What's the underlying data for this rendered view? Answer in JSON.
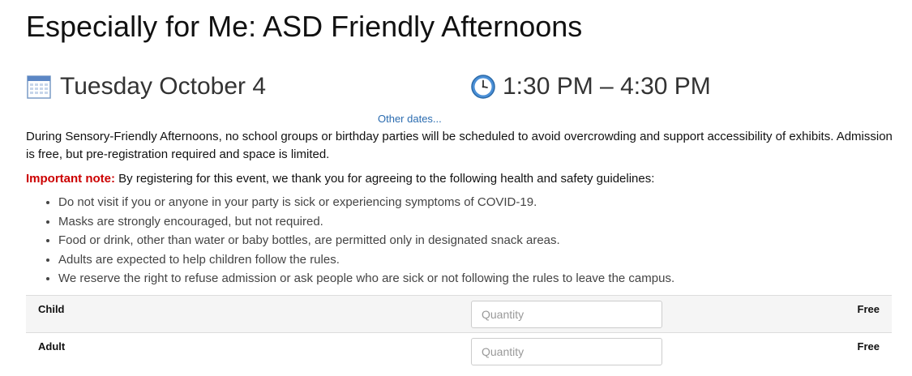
{
  "event": {
    "title": "Especially for Me: ASD Friendly Afternoons",
    "date": "Tuesday October 4",
    "time": "1:30 PM  –  4:30 PM",
    "other_dates_link": "Other dates...",
    "calendar_icon": "calendar-icon",
    "clock_icon": "clock-icon"
  },
  "description": "During Sensory-Friendly Afternoons, no school groups or birthday parties will be scheduled to avoid overcrowding and support accessibility of exhibits. Admission is free, but pre-registration required and space is limited.",
  "note": {
    "label": "Important note:",
    "text": " By registering for this event, we thank you for agreeing to the following health and safety guidelines:",
    "label_color": "#cc0000"
  },
  "guidelines": [
    "Do not visit if you or anyone in your party is sick or experiencing symptoms of COVID-19.",
    "Masks are strongly encouraged, but not required.",
    "Food or drink, other than water or baby bottles, are permitted only in designated snack areas.",
    "Adults are expected to help children follow the rules.",
    "We reserve the right to refuse admission or ask people who are sick or not following the rules to leave the campus."
  ],
  "tickets": [
    {
      "name": "Child",
      "quantity_placeholder": "Quantity",
      "price": "Free"
    },
    {
      "name": "Adult",
      "quantity_placeholder": "Quantity",
      "price": "Free"
    }
  ],
  "colors": {
    "link": "#2b6cb0",
    "row_shade": "#f5f5f5"
  }
}
